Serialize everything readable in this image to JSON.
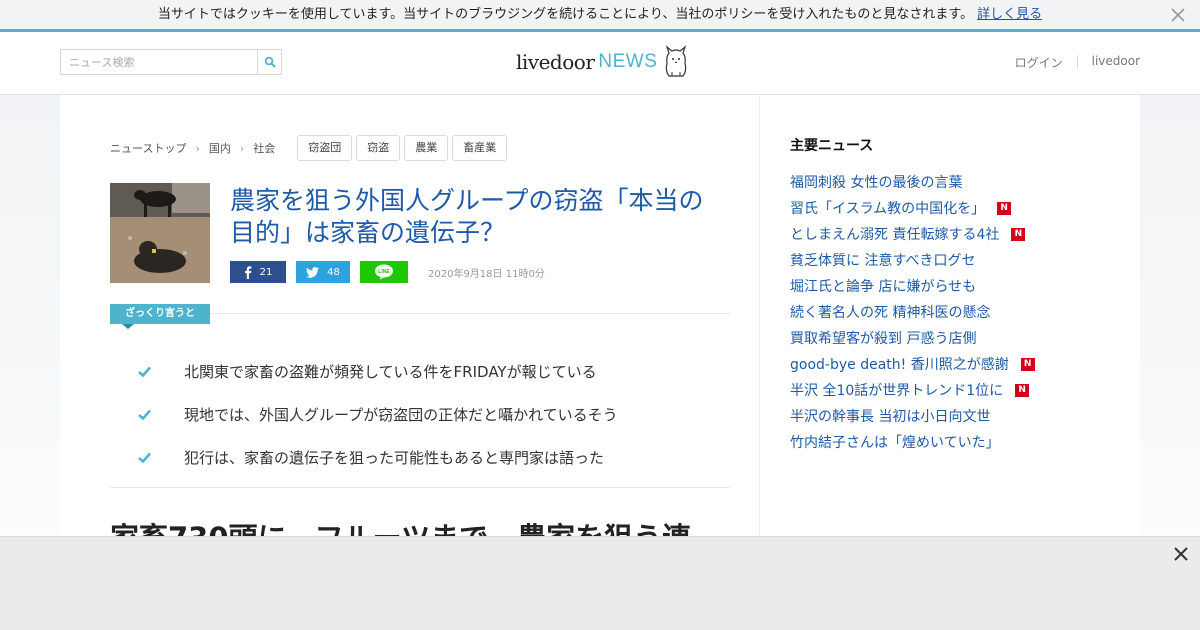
{
  "cookie_bar": {
    "text": "当サイトではクッキーを使用しています。当サイトのブラウジングを続けることにより、当社のポリシーを受け入れたものと見なされます。",
    "link": "詳しく見る"
  },
  "header": {
    "search_placeholder": "ニュース検索",
    "logo_main": "livedoor",
    "logo_news": "NEWS",
    "login": "ログイン",
    "livedoor_link": "livedoor"
  },
  "breadcrumb": [
    "ニューストップ",
    "国内",
    "社会"
  ],
  "tags": [
    "窃盗団",
    "窃盗",
    "農業",
    "畜産業"
  ],
  "article": {
    "title": "農家を狙う外国人グループの窃盗「本当の目的」は家畜の遺伝子？",
    "facebook_count": "21",
    "twitter_count": "48",
    "line_label": "LINE",
    "date": "2020年9月18日 11時0分",
    "summary_label": "ざっくり言うと",
    "summary": [
      "北関東で家畜の盗難が頻発している件をFRIDAYが報じている",
      "現地では、外国人グループが窃盗団の正体だと囁かれているそう",
      "犯行は、家畜の遺伝子を狙った可能性もあると専門家は語った"
    ],
    "headline2": "家畜730頭に、フルーツまで…農家を狙う連"
  },
  "sidebar": {
    "title": "主要ニュース",
    "items": [
      {
        "text": "福岡刺殺 女性の最後の言葉",
        "new": false
      },
      {
        "text": "習氏「イスラム教の中国化を」",
        "new": true
      },
      {
        "text": "としまえん溺死 責任転嫁する4社",
        "new": true
      },
      {
        "text": "貧乏体質に 注意すべき口グセ",
        "new": false
      },
      {
        "text": "堀江氏と論争 店に嫌がらせも",
        "new": false
      },
      {
        "text": "続く著名人の死 精神科医の懸念",
        "new": false
      },
      {
        "text": "買取希望客が殺到 戸惑う店側",
        "new": false
      },
      {
        "text": "good-bye death! 香川照之が感謝",
        "new": true
      },
      {
        "text": "半沢 全10話が世界トレンド1位に",
        "new": true
      },
      {
        "text": "半沢の幹事長 当初は小日向文世",
        "new": false
      },
      {
        "text": "竹内結子さんは「煌めいていた」",
        "new": false
      }
    ],
    "badge_label": "N"
  },
  "colors": {
    "accent": "#4db3cf",
    "link": "#1e5aa8",
    "facebook": "#2d4e8f",
    "twitter": "#2aa3df",
    "line": "#1ec800",
    "badge": "#d4001a"
  }
}
